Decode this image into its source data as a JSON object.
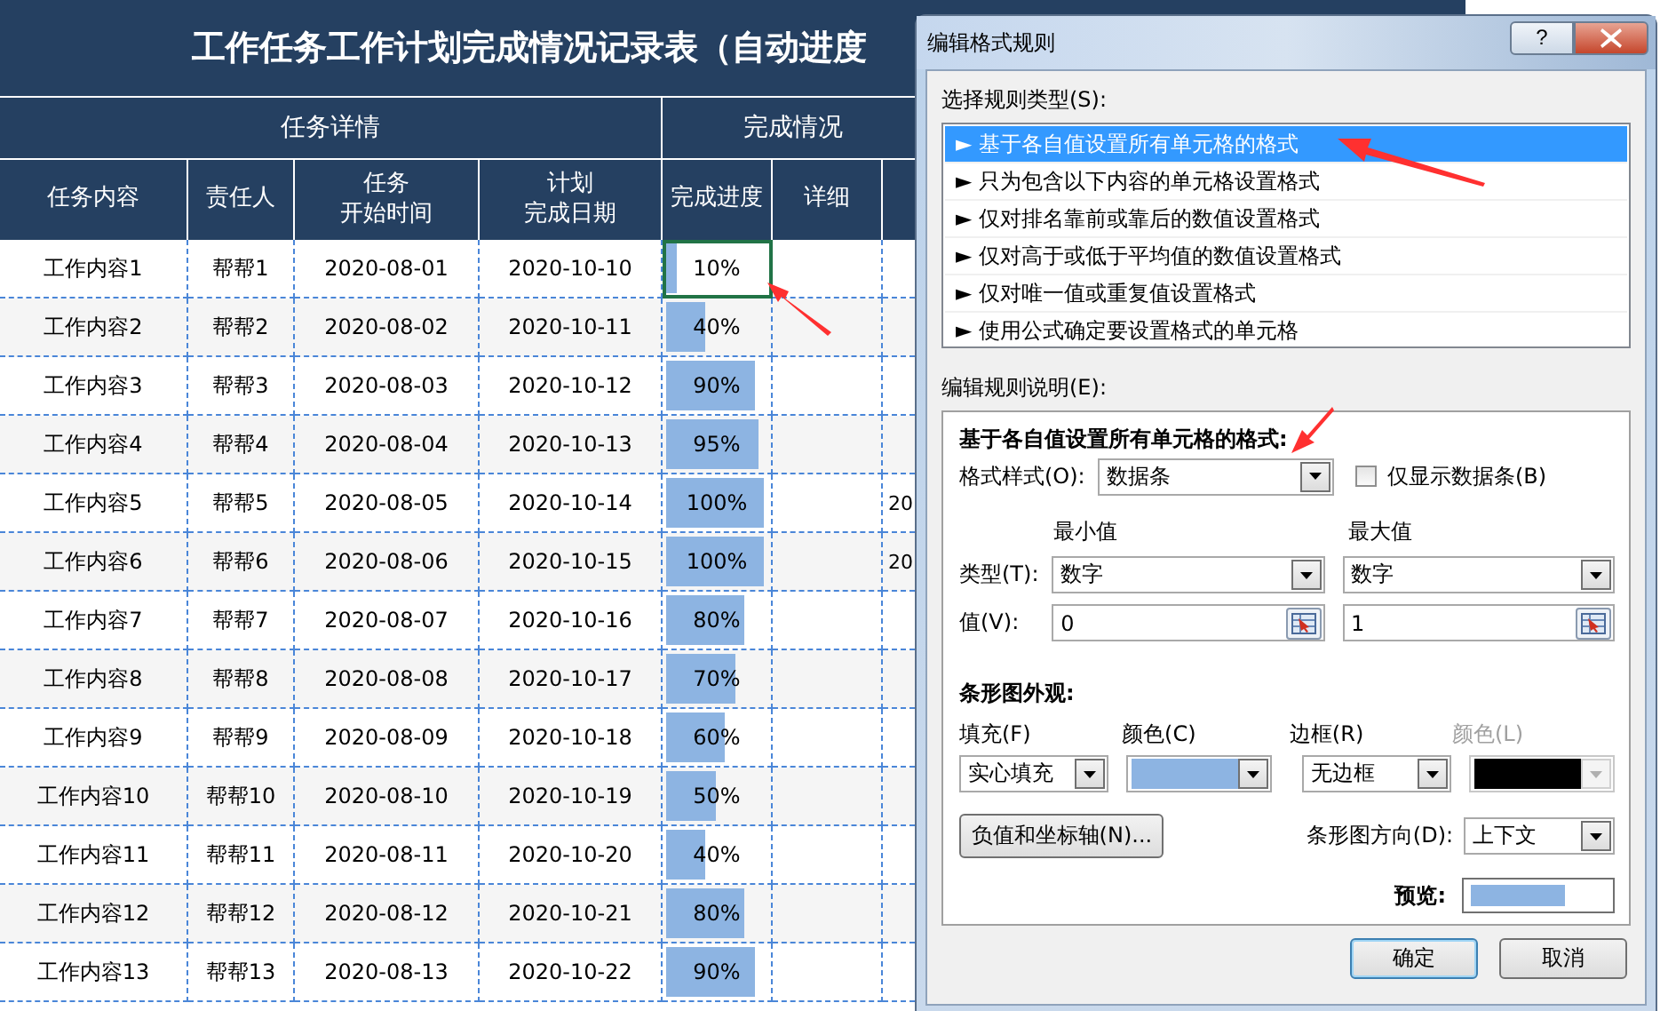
{
  "sheet": {
    "title": "工作任务工作计划完成情况记录表（自动进度",
    "group_headers": [
      "任务详情",
      "完成情况"
    ],
    "columns": [
      [
        "任务内容"
      ],
      [
        "责任人"
      ],
      [
        "任务",
        "开始时间"
      ],
      [
        "计划",
        "完成日期"
      ],
      [
        "完成进度"
      ],
      [
        "详细"
      ]
    ],
    "rows": [
      {
        "task": "工作内容1",
        "owner": "帮帮1",
        "start": "2020-08-01",
        "due": "2020-10-10",
        "progress": "10%",
        "level": 0.1,
        "selected": true
      },
      {
        "task": "工作内容2",
        "owner": "帮帮2",
        "start": "2020-08-02",
        "due": "2020-10-11",
        "progress": "40%",
        "level": 0.4,
        "selected": false
      },
      {
        "task": "工作内容3",
        "owner": "帮帮3",
        "start": "2020-08-03",
        "due": "2020-10-12",
        "progress": "90%",
        "level": 0.9,
        "selected": false
      },
      {
        "task": "工作内容4",
        "owner": "帮帮4",
        "start": "2020-08-04",
        "due": "2020-10-13",
        "progress": "95%",
        "level": 0.95,
        "selected": false
      },
      {
        "task": "工作内容5",
        "owner": "帮帮5",
        "start": "2020-08-05",
        "due": "2020-10-14",
        "progress": "100%",
        "level": 1,
        "selected": false,
        "column_7": "20"
      },
      {
        "task": "工作内容6",
        "owner": "帮帮6",
        "start": "2020-08-06",
        "due": "2020-10-15",
        "progress": "100%",
        "level": 1,
        "selected": false,
        "column_7": "20"
      },
      {
        "task": "工作内容7",
        "owner": "帮帮7",
        "start": "2020-08-07",
        "due": "2020-10-16",
        "progress": "80%",
        "level": 0.8,
        "selected": false
      },
      {
        "task": "工作内容8",
        "owner": "帮帮8",
        "start": "2020-08-08",
        "due": "2020-10-17",
        "progress": "70%",
        "level": 0.7,
        "selected": false
      },
      {
        "task": "工作内容9",
        "owner": "帮帮9",
        "start": "2020-08-09",
        "due": "2020-10-18",
        "progress": "60%",
        "level": 0.6,
        "selected": false
      },
      {
        "task": "工作内容10",
        "owner": "帮帮10",
        "start": "2020-08-10",
        "due": "2020-10-19",
        "progress": "50%",
        "level": 0.5,
        "selected": false
      },
      {
        "task": "工作内容11",
        "owner": "帮帮11",
        "start": "2020-08-11",
        "due": "2020-10-20",
        "progress": "40%",
        "level": 0.4,
        "selected": false
      },
      {
        "task": "工作内容12",
        "owner": "帮帮12",
        "start": "2020-08-12",
        "due": "2020-10-21",
        "progress": "80%",
        "level": 0.8,
        "selected": false
      },
      {
        "task": "工作内容13",
        "owner": "帮帮13",
        "start": "2020-08-13",
        "due": "2020-10-22",
        "progress": "90%",
        "level": 0.9,
        "selected": false
      }
    ]
  },
  "dialog": {
    "title": "编辑格式规则",
    "help_label": "?",
    "rule_type_label": "选择规则类型(S):",
    "rule_types": [
      {
        "label": "► 基于各自值设置所有单元格的格式",
        "selected": true
      },
      {
        "label": "► 只为包含以下内容的单元格设置格式",
        "selected": false
      },
      {
        "label": "► 仅对排名靠前或靠后的数值设置格式",
        "selected": false
      },
      {
        "label": "► 仅对高于或低于平均值的数值设置格式",
        "selected": false
      },
      {
        "label": "► 仅对唯一值或重复值设置格式",
        "selected": false
      },
      {
        "label": "► 使用公式确定要设置格式的单元格",
        "selected": false
      }
    ],
    "description_label": "编辑规则说明(E):",
    "description_title": "基于各自值设置所有单元格的格式:",
    "format_style": {
      "label": "格式样式(O):",
      "value": "数据条"
    },
    "bar_only": {
      "label": "仅显示数据条(B)",
      "checked": false
    },
    "min": {
      "heading": "最小值",
      "type": "数字",
      "value": "0"
    },
    "max": {
      "heading": "最大值",
      "type": "数字",
      "value": "1"
    },
    "type_label": "类型(T):",
    "value_label": "值(V):",
    "appearance_title": "条形图外观:",
    "fill": {
      "label": "填充(F)",
      "value": "实心填充"
    },
    "fill_color": {
      "label": "颜色(C)",
      "color": "#8db4e2"
    },
    "border": {
      "label": "边框(R)",
      "value": "无边框"
    },
    "border_color": {
      "label": "颜色(L)",
      "color": "#000000",
      "disabled": true
    },
    "axis_button": "负值和坐标轴(N)...",
    "direction": {
      "label": "条形图方向(D):",
      "value": "上下文"
    },
    "preview_label": "预览:",
    "buttons": [
      {
        "label": "确定",
        "kind": "default"
      },
      {
        "label": "取消",
        "kind": "normal"
      }
    ]
  }
}
